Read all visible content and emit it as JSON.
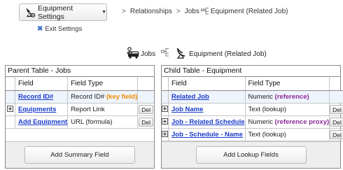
{
  "toolbar": {
    "settings_label": "Equipment Settings",
    "settings_icon": "satellite-gear-icon",
    "exit_label": "Exit Settings"
  },
  "breadcrumb": {
    "items": [
      "Relationships",
      "Jobs",
      "Equipment (Related Job)"
    ],
    "separator": ">",
    "relationship_icon": "relationship-link-icon"
  },
  "heading": {
    "parent": "Jobs",
    "child": "Equipment (Related Job)",
    "parent_icon": "people-car-icon",
    "child_icon": "satellite-dish-icon"
  },
  "parent_table": {
    "title": "Parent Table - Jobs",
    "col_field": "Field",
    "col_type": "Field Type",
    "rows": [
      {
        "field": "Record ID#",
        "type": "Record ID#",
        "note": "(key field)",
        "expand": false,
        "del": false
      },
      {
        "field": "Equipments",
        "type": "Report Link",
        "note": "",
        "expand": true,
        "del": true
      },
      {
        "field": "Add Equipment",
        "type": "URL (formula)",
        "note": "",
        "expand": false,
        "del": true
      }
    ],
    "footer_button": "Add Summary Field"
  },
  "child_table": {
    "title": "Child Table - Equipment",
    "col_field": "Field",
    "col_type": "Field Type",
    "rows": [
      {
        "field": "Related Job",
        "type": "Numeric",
        "note": "(reference)",
        "expand": false,
        "del": false
      },
      {
        "field": "Job Name",
        "type": "Text (lookup)",
        "note": "",
        "expand": true,
        "del": true
      },
      {
        "field": "Job - Related Schedule",
        "type": "Numeric",
        "note": "(reference proxy)",
        "expand": true,
        "del": true
      },
      {
        "field": "Job - Schedule - Name",
        "type": "Text (lookup)",
        "note": "",
        "expand": true,
        "del": true
      }
    ],
    "footer_button": "Add Lookup Fields"
  },
  "del_label": "Del",
  "colors": {
    "link": "#1a3ccb",
    "key_field": "#f08a00",
    "reference": "#8a2c9a",
    "exit_x": "#3b73c8"
  }
}
